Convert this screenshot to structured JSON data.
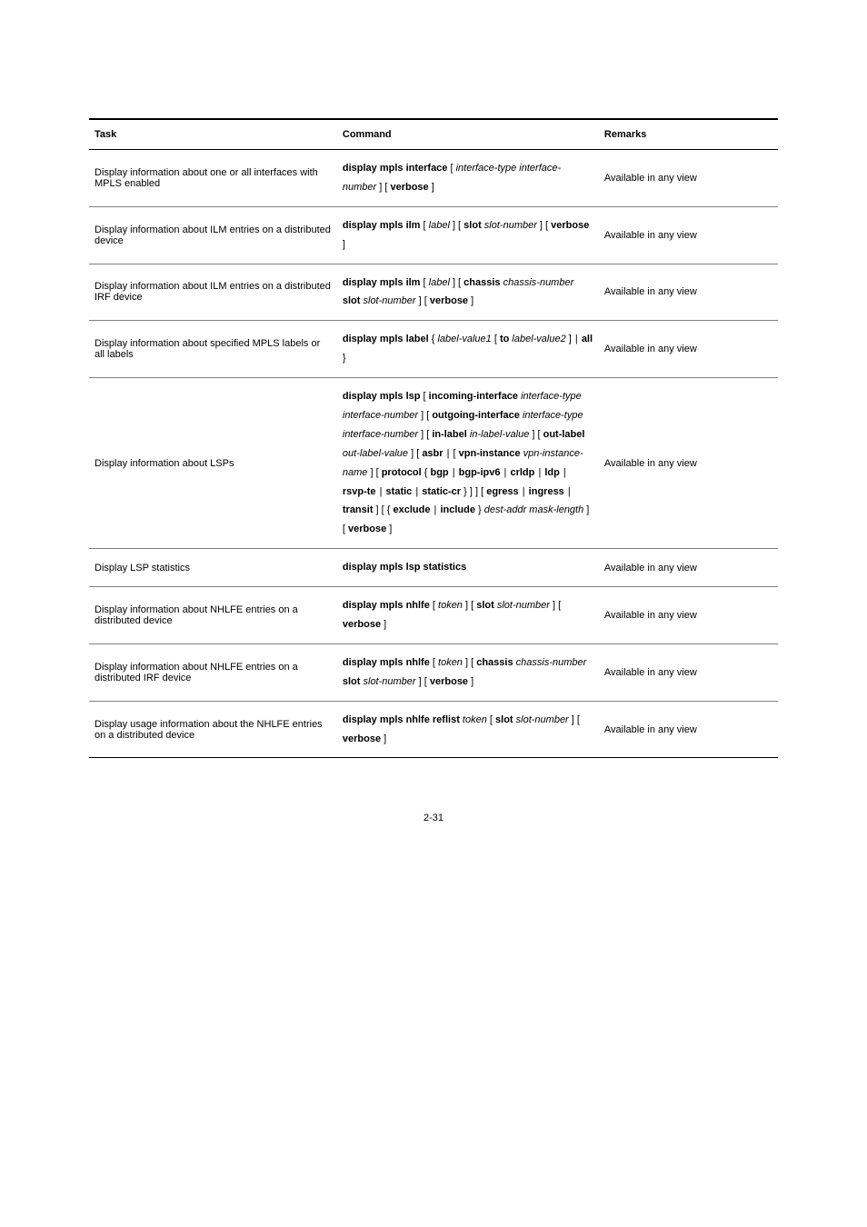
{
  "header": {
    "c1": "Task",
    "c2": "Command",
    "c3": "Remarks"
  },
  "rows": [
    {
      "task": "Display information about one or all interfaces with MPLS enabled",
      "cmd": {
        "pre": "display mpls interface",
        "segs": [
          {
            "t": " [ "
          },
          {
            "i": "interface-type interface-number"
          },
          {
            "t": " ] [ "
          },
          {
            "k": "verbose"
          },
          {
            "t": " ]"
          }
        ]
      },
      "rem": "Available in any view"
    },
    {
      "task": "Display information about ILM entries on a distributed device",
      "cmd": {
        "pre": "display mpls ilm",
        "segs": [
          {
            "t": " [ "
          },
          {
            "i": "label"
          },
          {
            "t": " ] [ "
          },
          {
            "k": "slot"
          },
          {
            "t": " "
          },
          {
            "i": "slot-number"
          },
          {
            "t": " ] [ "
          },
          {
            "k": "verbose"
          },
          {
            "t": " ]"
          }
        ]
      },
      "rem": "Available in any view"
    },
    {
      "task": "Display information about ILM entries on a distributed IRF device",
      "cmd": {
        "pre": "display mpls ilm",
        "segs": [
          {
            "t": " [ "
          },
          {
            "i": "label"
          },
          {
            "t": " ] [ "
          },
          {
            "k": "chassis"
          },
          {
            "t": " "
          },
          {
            "i": "chassis-number"
          },
          {
            "t": " "
          },
          {
            "k": "slot"
          },
          {
            "t": " "
          },
          {
            "i": "slot-number"
          },
          {
            "t": " ] [ "
          },
          {
            "k": "verbose"
          },
          {
            "t": " ]"
          }
        ]
      },
      "rem": "Available in any view"
    },
    {
      "task": "Display information about specified MPLS labels or all labels",
      "cmd": {
        "pre": "display mpls label",
        "segs": [
          {
            "t": " { "
          },
          {
            "i": "label-value1"
          },
          {
            "t": " [ "
          },
          {
            "k": "to"
          },
          {
            "t": " "
          },
          {
            "i": "label-value2"
          },
          {
            "t": " ] | "
          },
          {
            "k": "all"
          },
          {
            "t": " }"
          }
        ]
      },
      "rem": "Available in any view"
    },
    {
      "task": "Display information about LSPs",
      "cmd": {
        "pre": "display mpls lsp",
        "segs": [
          {
            "t": " [ "
          },
          {
            "k": "incoming-interface"
          },
          {
            "t": " "
          },
          {
            "i": "interface-type interface-number"
          },
          {
            "t": " ] [ "
          },
          {
            "k": "outgoing-interface"
          },
          {
            "t": " "
          },
          {
            "i": "interface-type interface-number"
          },
          {
            "t": " ] [ "
          },
          {
            "k": "in-label"
          },
          {
            "t": " "
          },
          {
            "i": "in-label-value"
          },
          {
            "t": " ] [ "
          },
          {
            "k": "out-label"
          },
          {
            "t": " "
          },
          {
            "i": "out-label-value"
          },
          {
            "t": " ] [ "
          },
          {
            "k": "asbr"
          },
          {
            "t": " | [ "
          },
          {
            "k": "vpn-instance"
          },
          {
            "t": " "
          },
          {
            "i": "vpn-instance-name"
          },
          {
            "t": " ] [ "
          },
          {
            "k": "protocol"
          },
          {
            "t": " { "
          },
          {
            "k": "bgp"
          },
          {
            "t": " | "
          },
          {
            "k": "bgp-ipv6"
          },
          {
            "t": " | "
          },
          {
            "k": "crldp"
          },
          {
            "t": " | "
          },
          {
            "k": "ldp"
          },
          {
            "t": " | "
          },
          {
            "k": "rsvp-te"
          },
          {
            "t": " | "
          },
          {
            "k": "static"
          },
          {
            "t": " | "
          },
          {
            "k": "static-cr"
          },
          {
            "t": " } ] ] [ "
          },
          {
            "k": "egress"
          },
          {
            "t": " | "
          },
          {
            "k": "ingress"
          },
          {
            "t": " | "
          },
          {
            "k": "transit"
          },
          {
            "t": " ] [ { "
          },
          {
            "k": "exclude"
          },
          {
            "t": " | "
          },
          {
            "k": "include"
          },
          {
            "t": " } "
          },
          {
            "i": "dest-addr mask-length"
          },
          {
            "t": " ] [ "
          },
          {
            "k": "verbose"
          },
          {
            "t": " ]"
          }
        ]
      },
      "rem": "Available in any view"
    },
    {
      "task": "Display LSP statistics",
      "cmd": {
        "pre": "display mpls lsp statistics",
        "segs": []
      },
      "rem": "Available in any view"
    },
    {
      "task": "Display information about NHLFE entries on a distributed device",
      "cmd": {
        "pre": "display mpls nhlfe",
        "segs": [
          {
            "t": " [ "
          },
          {
            "i": "token"
          },
          {
            "t": " ] [ "
          },
          {
            "k": "slot"
          },
          {
            "t": " "
          },
          {
            "i": "slot-number"
          },
          {
            "t": " ] [ "
          },
          {
            "k": "verbose"
          },
          {
            "t": " ]"
          }
        ]
      },
      "rem": "Available in any view"
    },
    {
      "task": "Display information about NHLFE entries on a distributed IRF device",
      "cmd": {
        "pre": "display mpls nhlfe",
        "segs": [
          {
            "t": " [ "
          },
          {
            "i": "token"
          },
          {
            "t": " ] [ "
          },
          {
            "k": "chassis"
          },
          {
            "t": " "
          },
          {
            "i": "chassis-number"
          },
          {
            "t": " "
          },
          {
            "k": "slot"
          },
          {
            "t": " "
          },
          {
            "i": "slot-number"
          },
          {
            "t": " ] [ "
          },
          {
            "k": "verbose"
          },
          {
            "t": " ]"
          }
        ]
      },
      "rem": "Available in any view"
    },
    {
      "task": "Display usage information about the NHLFE entries on a distributed device",
      "cmd": {
        "pre": "display mpls nhlfe reflist",
        "segs": [
          {
            "t": " "
          },
          {
            "i": "token"
          },
          {
            "t": " [ "
          },
          {
            "k": "slot"
          },
          {
            "t": " "
          },
          {
            "i": "slot-number"
          },
          {
            "t": " ] [ "
          },
          {
            "k": "verbose"
          },
          {
            "t": " ]"
          }
        ]
      },
      "rem": "Available in any view"
    }
  ],
  "pagenum": "2-31"
}
